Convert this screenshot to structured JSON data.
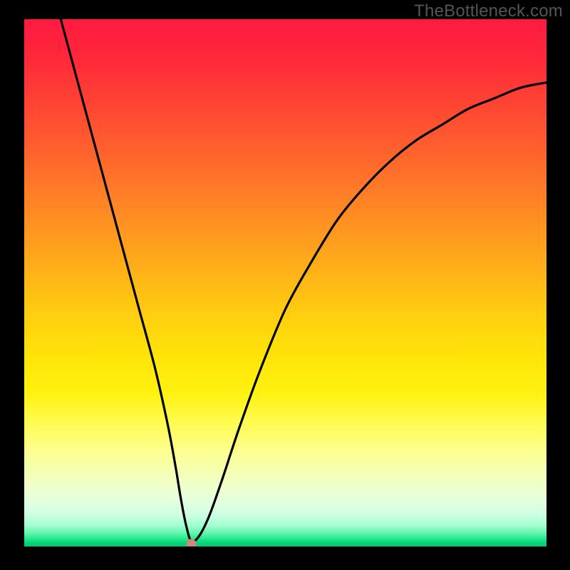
{
  "watermark": "TheBottleneck.com",
  "chart_data": {
    "type": "line",
    "title": "",
    "xlabel": "",
    "ylabel": "",
    "xlim": [
      0,
      100
    ],
    "ylim": [
      0,
      100
    ],
    "x": [
      7,
      10,
      13,
      16,
      19,
      22,
      25,
      27.5,
      29,
      30,
      31,
      32,
      33.5,
      35.5,
      38,
      41,
      45,
      50,
      55,
      60,
      65,
      70,
      75,
      80,
      85,
      90,
      95,
      100
    ],
    "values": [
      100,
      89,
      78,
      67,
      56,
      45,
      34,
      23,
      15,
      9,
      4,
      1,
      2,
      6,
      13,
      22,
      33,
      45,
      54,
      62,
      68,
      73,
      77,
      80,
      83,
      85,
      87,
      88
    ],
    "marker": {
      "x": 32,
      "y": 0.5
    },
    "background_zones": [
      {
        "y": 100,
        "color": "#ff1a40"
      },
      {
        "y": 50,
        "color": "#ffd010"
      },
      {
        "y": 20,
        "color": "#fff880"
      },
      {
        "y": 5,
        "color": "#d0ffd8"
      },
      {
        "y": 0,
        "color": "#05c86f"
      }
    ]
  }
}
